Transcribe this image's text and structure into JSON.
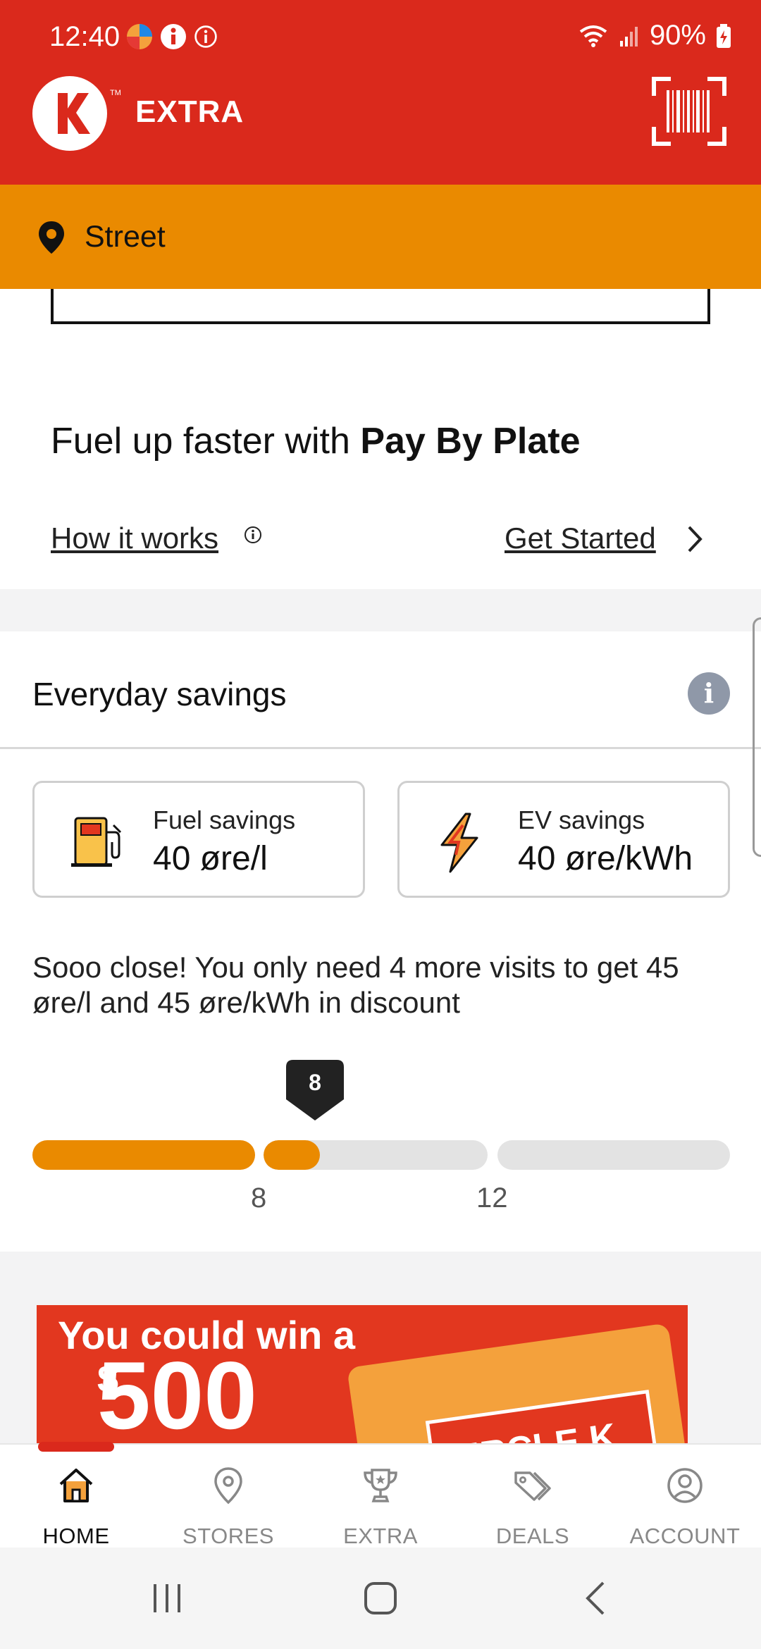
{
  "status_bar": {
    "time": "12:40",
    "battery": "90%"
  },
  "header": {
    "app_title": "EXTRA",
    "logo_tm": "TM"
  },
  "location": {
    "label": "Street"
  },
  "pay_by_plate": {
    "title_prefix": "Fuel up faster with ",
    "title_bold": "Pay By Plate",
    "how_link": "How it works",
    "get_started": "Get Started"
  },
  "savings": {
    "title": "Everyday savings",
    "fuel": {
      "label": "Fuel savings",
      "value": "40 øre/l"
    },
    "ev": {
      "label": "EV savings",
      "value": "40 øre/kWh"
    },
    "message": "Sooo close! You only need 4 more visits to get 45 øre/l and 45 øre/kWh in discount",
    "progress": {
      "current": "8",
      "tick_1": "8",
      "tick_2": "12"
    }
  },
  "promo": {
    "line1": "You could win a",
    "dollar": "$",
    "amount": "500",
    "card_text": "CIRCLE K"
  },
  "nav": {
    "items": [
      {
        "label": "HOME",
        "icon": "home-icon"
      },
      {
        "label": "STORES",
        "icon": "location-pin-icon"
      },
      {
        "label": "EXTRA",
        "icon": "trophy-icon"
      },
      {
        "label": "DEALS",
        "icon": "tags-icon"
      },
      {
        "label": "ACCOUNT",
        "icon": "account-icon"
      }
    ]
  },
  "colors": {
    "brand_red": "#DA291C",
    "brand_orange": "#EA8A00"
  }
}
